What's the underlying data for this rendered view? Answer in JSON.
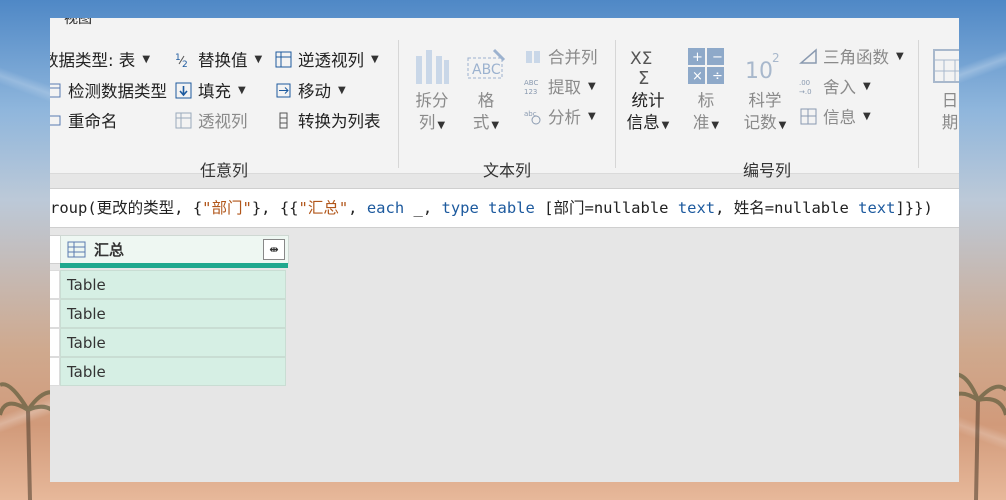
{
  "ribbon": {
    "tab_label": "视图",
    "groups": {
      "any_column": {
        "label": "任意列",
        "data_type": "数据类型: 表",
        "detect_type": "检测数据类型",
        "rename": "重命名",
        "replace_values": "替换值",
        "fill": "填充",
        "pivot": "透视列",
        "unpivot": "逆透视列",
        "move": "移动",
        "to_list": "转换为列表"
      },
      "text_column": {
        "label": "文本列",
        "split": "拆分\n列",
        "split_l1": "拆分",
        "split_l2": "列",
        "format_l1": "格",
        "format_l2": "式",
        "merge": "合并列",
        "extract": "提取",
        "parse": "分析"
      },
      "number_column": {
        "label": "编号列",
        "stats_l1": "统计",
        "stats_l2": "信息",
        "standard_l1": "标",
        "standard_l2": "准",
        "sci_l1": "科学",
        "sci_l2": "记数",
        "trig": "三角函数",
        "round": "舍入",
        "info": "信息"
      },
      "date_column": {
        "l1": "日",
        "l2": "期"
      }
    }
  },
  "formula": {
    "p1": "roup(更改的类型, {",
    "p2": "\"部门\"",
    "p3": "}, {{",
    "p4": "\"汇总\"",
    "p5": ", ",
    "p6": "each",
    "p7": " _, ",
    "p8": "type table",
    "p9": " [部门=nullable ",
    "p10": "text",
    "p11": ", 姓名=nullable ",
    "p12": "text",
    "p13": "]}})"
  },
  "grid": {
    "column_header": "汇总",
    "rows": [
      "Table",
      "Table",
      "Table",
      "Table"
    ]
  },
  "colors": {
    "accent": "#1fa88e",
    "cell_bg": "#d6efe4",
    "keyword": "#1d5a9e",
    "string": "#b1561a"
  }
}
